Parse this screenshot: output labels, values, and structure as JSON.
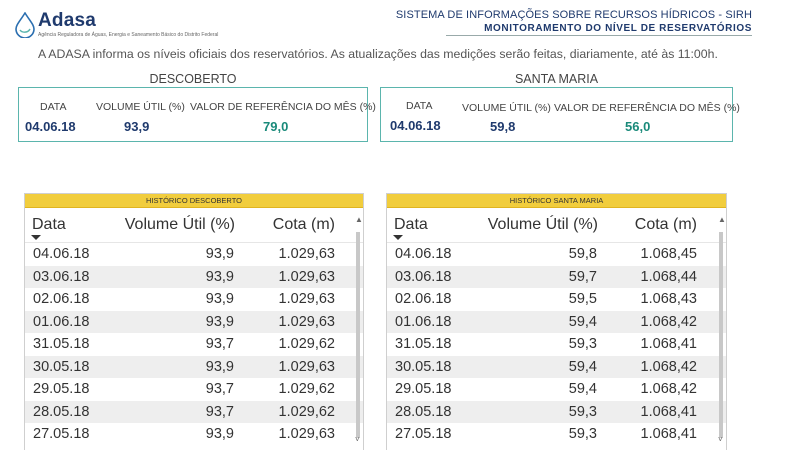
{
  "header": {
    "logo_title": "Adasa",
    "logo_subtitle": "Agência Reguladora de Águas, Energia e Saneamento Básico do Distrito Federal",
    "system_title": "SISTEMA DE INFORMAÇÕES SOBRE RECURSOS HÍDRICOS - SIRH",
    "system_subtitle": "MONITORAMENTO DO NÍVEL DE RESERVATÓRIOS"
  },
  "notice": "A ADASA informa os níveis oficiais dos reservatórios. As atualizações das medições serão feitas, diariamente, até às 11:00h.",
  "reservoirs": [
    {
      "name": "DESCOBERTO",
      "labels": {
        "date": "DATA",
        "volume": "VOLUME ÚTIL (%)",
        "reference": "VALOR DE REFERÊNCIA DO MÊS (%)"
      },
      "values": {
        "date": "04.06.18",
        "volume": "93,9",
        "reference": "79,0"
      }
    },
    {
      "name": "SANTA MARIA",
      "labels": {
        "date": "DATA",
        "volume": "VOLUME ÚTIL (%)",
        "reference": "VALOR DE REFERÊNCIA DO MÊS (%)"
      },
      "values": {
        "date": "04.06.18",
        "volume": "59,8",
        "reference": "56,0"
      }
    }
  ],
  "history": [
    {
      "title": "HISTÓRICO DESCOBERTO",
      "columns": [
        "Data",
        "Volume Útil (%)",
        "Cota (m)"
      ],
      "rows": [
        [
          "04.06.18",
          "93,9",
          "1.029,63"
        ],
        [
          "03.06.18",
          "93,9",
          "1.029,63"
        ],
        [
          "02.06.18",
          "93,9",
          "1.029,63"
        ],
        [
          "01.06.18",
          "93,9",
          "1.029,63"
        ],
        [
          "31.05.18",
          "93,7",
          "1.029,62"
        ],
        [
          "30.05.18",
          "93,9",
          "1.029,63"
        ],
        [
          "29.05.18",
          "93,7",
          "1.029,62"
        ],
        [
          "28.05.18",
          "93,7",
          "1.029,62"
        ],
        [
          "27.05.18",
          "93,9",
          "1.029,63"
        ]
      ]
    },
    {
      "title": "HISTÓRICO SANTA MARIA",
      "columns": [
        "Data",
        "Volume Útil (%)",
        "Cota (m)"
      ],
      "rows": [
        [
          "04.06.18",
          "59,8",
          "1.068,45"
        ],
        [
          "03.06.18",
          "59,7",
          "1.068,44"
        ],
        [
          "02.06.18",
          "59,5",
          "1.068,43"
        ],
        [
          "01.06.18",
          "59,4",
          "1.068,42"
        ],
        [
          "31.05.18",
          "59,3",
          "1.068,41"
        ],
        [
          "30.05.18",
          "59,4",
          "1.068,42"
        ],
        [
          "29.05.18",
          "59,4",
          "1.068,42"
        ],
        [
          "28.05.18",
          "59,3",
          "1.068,41"
        ],
        [
          "27.05.18",
          "59,3",
          "1.068,41"
        ]
      ]
    }
  ],
  "icons": {
    "logo": "water-drop-icon",
    "sort": "sort-desc-icon",
    "scroll_up": "chevron-up-icon",
    "scroll_down": "chevron-down-icon"
  },
  "colors": {
    "brand": "#1f3a6d",
    "accent": "#5bb5ad",
    "value_ref": "#1a8a7a",
    "table_header": "#f1cd3d"
  }
}
